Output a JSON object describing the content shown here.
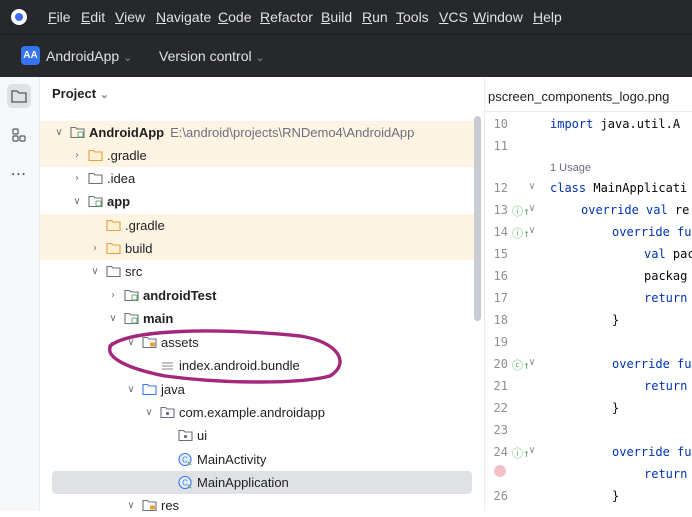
{
  "menubar": {
    "items": [
      "File",
      "Edit",
      "View",
      "Navigate",
      "Code",
      "Refactor",
      "Build",
      "Run",
      "Tools",
      "VCS",
      "Window",
      "Help"
    ]
  },
  "toolbar": {
    "project_badge": "AA",
    "project_name": "AndroidApp",
    "vcs_label": "Version control"
  },
  "tool_stripe": {
    "icons": [
      "folder-icon",
      "structure-icon",
      "more-icon"
    ]
  },
  "project_panel": {
    "title": "Project",
    "tree": [
      {
        "label": "AndroidApp",
        "path": "E:\\android\\projects\\RNDemo4\\AndroidApp",
        "icon": "module",
        "bold": true,
        "arrow": "open"
      },
      {
        "label": ".gradle",
        "icon": "folder-orange",
        "arrow": "closed"
      },
      {
        "label": ".idea",
        "icon": "folder",
        "arrow": "closed"
      },
      {
        "label": "app",
        "icon": "module",
        "bold": true,
        "arrow": "open"
      },
      {
        "label": ".gradle",
        "icon": "folder-orange",
        "arrow": "none"
      },
      {
        "label": "build",
        "icon": "folder-orange",
        "arrow": "closed"
      },
      {
        "label": "src",
        "icon": "folder",
        "arrow": "open"
      },
      {
        "label": "androidTest",
        "icon": "module",
        "bold": true,
        "arrow": "closed"
      },
      {
        "label": "main",
        "icon": "module",
        "bold": true,
        "arrow": "open"
      },
      {
        "label": "assets",
        "icon": "folder-res",
        "arrow": "open"
      },
      {
        "label": "index.android.bundle",
        "icon": "file",
        "arrow": "none"
      },
      {
        "label": "java",
        "icon": "folder-src",
        "arrow": "open"
      },
      {
        "label": "com.example.androidapp",
        "icon": "package",
        "arrow": "open"
      },
      {
        "label": "ui",
        "icon": "package",
        "arrow": "none"
      },
      {
        "label": "MainActivity",
        "icon": "class",
        "arrow": "none"
      },
      {
        "label": "MainApplication",
        "icon": "class",
        "arrow": "none"
      },
      {
        "label": "res",
        "icon": "folder-res",
        "arrow": "open"
      }
    ]
  },
  "editor": {
    "tab_label": "pscreen_components_logo.png",
    "usage_hint": "1 Usage",
    "lines": [
      {
        "num": "10",
        "text": "import java.util.A"
      },
      {
        "num": "11",
        "text": ""
      },
      {
        "num": "12",
        "text": "class MainApplicati"
      },
      {
        "num": "13",
        "text": "override val re"
      },
      {
        "num": "14",
        "text": "override fu"
      },
      {
        "num": "15",
        "text": "val pac"
      },
      {
        "num": "16",
        "text": "packag"
      },
      {
        "num": "17",
        "text": "return"
      },
      {
        "num": "18",
        "text": "}"
      },
      {
        "num": "19",
        "text": ""
      },
      {
        "num": "20",
        "text": "override fu"
      },
      {
        "num": "21",
        "text": "return"
      },
      {
        "num": "22",
        "text": "}"
      },
      {
        "num": "23",
        "text": ""
      },
      {
        "num": "24",
        "text": "override fu"
      },
      {
        "num": "",
        "text": "return"
      },
      {
        "num": "26",
        "text": "}"
      }
    ]
  },
  "colors": {
    "annotation": "#a3277a",
    "highlight_row": "#fdf4e3",
    "selected_row": "#dfe1e5",
    "keyword": "#0033b3"
  }
}
